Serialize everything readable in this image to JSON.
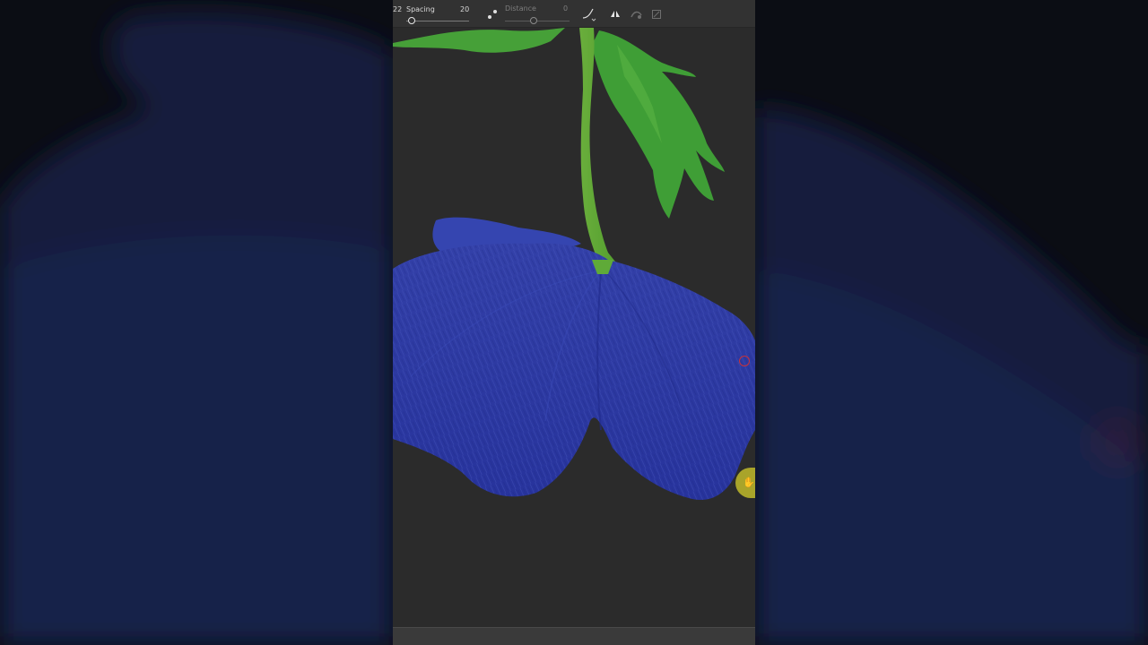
{
  "toolbar": {
    "size_value": "22",
    "spacing_label": "Spacing",
    "spacing_value": "20",
    "spacing_level": 0.08,
    "distance_label": "Distance",
    "distance_value": "0",
    "distance_level": 0.45,
    "icons": [
      "scatter-dots-icon",
      "pressure-curve-icon",
      "symmetry-icon",
      "stroke-mode-icon",
      "transform-icon"
    ]
  },
  "canvas": {
    "background_color": "#2b2b2b",
    "petal_color": "#2b3aa8",
    "stem_color": "#5ea83a",
    "leaf_color": "#3f9e36"
  },
  "colors": {
    "toolbar_bg": "#323232",
    "side_bg": "#0b0d14",
    "cursor_ring": "#c8323a",
    "stylus_button": "#a9a42a"
  }
}
